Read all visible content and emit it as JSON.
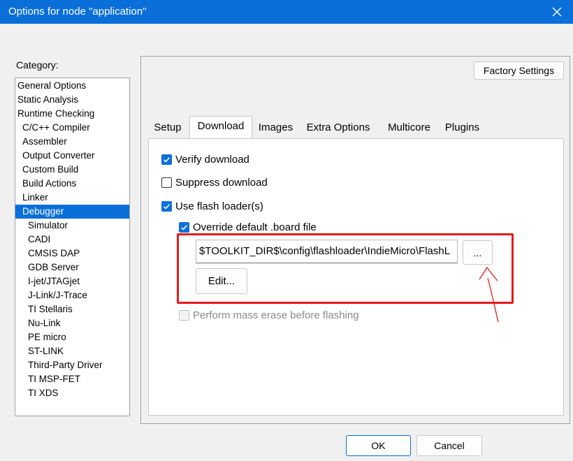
{
  "window": {
    "title": "Options for node \"application\"",
    "close_icon": "close-icon"
  },
  "category": {
    "label": "Category:",
    "items": [
      {
        "label": "General Options",
        "indent": 0
      },
      {
        "label": "Static Analysis",
        "indent": 0
      },
      {
        "label": "Runtime Checking",
        "indent": 0
      },
      {
        "label": "C/C++ Compiler",
        "indent": 1
      },
      {
        "label": "Assembler",
        "indent": 1
      },
      {
        "label": "Output Converter",
        "indent": 1
      },
      {
        "label": "Custom Build",
        "indent": 1
      },
      {
        "label": "Build Actions",
        "indent": 1
      },
      {
        "label": "Linker",
        "indent": 1
      },
      {
        "label": "Debugger",
        "indent": 1,
        "selected": true
      },
      {
        "label": "Simulator",
        "indent": 2
      },
      {
        "label": "CADI",
        "indent": 2
      },
      {
        "label": "CMSIS DAP",
        "indent": 2
      },
      {
        "label": "GDB Server",
        "indent": 2
      },
      {
        "label": "I-jet/JTAGjet",
        "indent": 2
      },
      {
        "label": "J-Link/J-Trace",
        "indent": 2
      },
      {
        "label": "TI Stellaris",
        "indent": 2
      },
      {
        "label": "Nu-Link",
        "indent": 2
      },
      {
        "label": "PE micro",
        "indent": 2
      },
      {
        "label": "ST-LINK",
        "indent": 2
      },
      {
        "label": "Third-Party Driver",
        "indent": 2
      },
      {
        "label": "TI MSP-FET",
        "indent": 2
      },
      {
        "label": "TI XDS",
        "indent": 2
      }
    ]
  },
  "factory_settings": "Factory Settings",
  "tabs": [
    "Setup",
    "Download",
    "Images",
    "Extra Options",
    "Multicore",
    "Plugins"
  ],
  "active_tab": "Download",
  "download": {
    "verify": {
      "label": "Verify download",
      "checked": true
    },
    "suppress": {
      "label": "Suppress download",
      "checked": false
    },
    "flash_loader": {
      "label": "Use flash loader(s)",
      "checked": true
    },
    "override": {
      "label": "Override default .board file",
      "checked": true
    },
    "board_path": "$TOOLKIT_DIR$\\config\\flashloader\\IndieMicro\\FlashL",
    "browse_label": "...",
    "edit_label": "Edit...",
    "mass_erase": {
      "label": "Perform mass erase before flashing",
      "checked": false,
      "disabled": true
    }
  },
  "footer": {
    "ok": "OK",
    "cancel": "Cancel"
  },
  "colors": {
    "accent": "#0a6fd8",
    "annotation": "#e31b1b"
  }
}
